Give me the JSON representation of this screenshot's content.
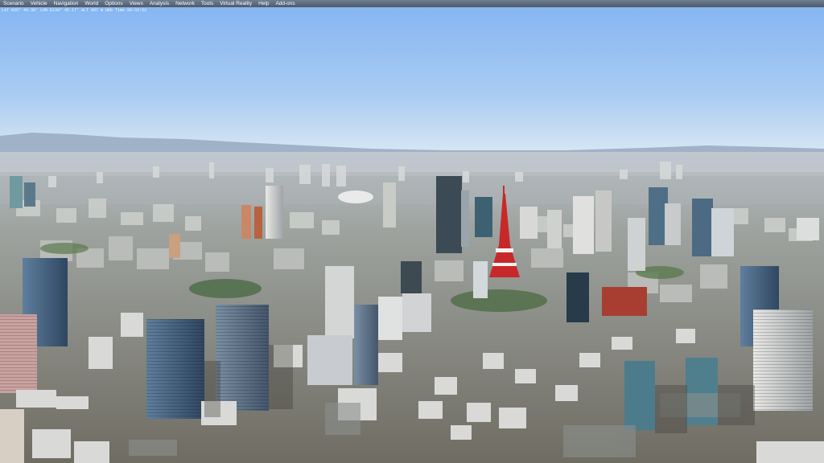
{
  "menubar": {
    "items": [
      "Scenario",
      "Vehicle",
      "Navigation",
      "World",
      "Options",
      "Views",
      "Analysis",
      "Network",
      "Tools",
      "Virtual Reality",
      "Help",
      "Add-ons"
    ]
  },
  "status": "LAT N35° 40.38'  LON E139° 45.17'  ALT 897 m  HDG  Time 08:33:52",
  "colors": {
    "menubar": "#5a6779",
    "sky_top": "#86b6f2",
    "sky_horizon": "#cfe4f5",
    "tower_red": "#c9282a"
  },
  "icons": []
}
